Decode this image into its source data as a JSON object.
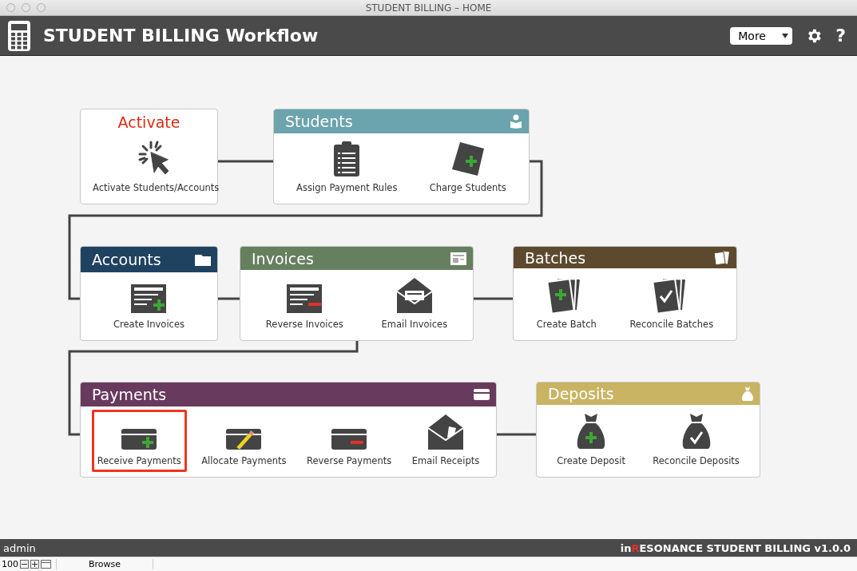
{
  "window": {
    "title": "STUDENT BILLING – HOME"
  },
  "toolbar": {
    "title": "STUDENT BILLING Workflow",
    "menu": "More",
    "help": "?"
  },
  "cards": [
    {
      "title": "Activate",
      "kind": "plain",
      "actions": [
        {
          "label": "Activate Students/Accounts",
          "selected": false
        }
      ]
    },
    {
      "title": "Students",
      "kind": "header",
      "color": "#6ba4ad",
      "actions": [
        {
          "label": "Assign Payment Rules",
          "selected": false
        },
        {
          "label": "Charge Students",
          "selected": false
        }
      ]
    },
    {
      "title": "Accounts",
      "kind": "header",
      "color": "#1f4261",
      "actions": [
        {
          "label": "Create Invoices",
          "selected": false
        }
      ]
    },
    {
      "title": "Invoices",
      "kind": "header",
      "color": "#66805f",
      "actions": [
        {
          "label": "Reverse Invoices",
          "selected": false
        },
        {
          "label": "Email Invoices",
          "selected": false
        }
      ]
    },
    {
      "title": "Batches",
      "kind": "header",
      "color": "#5d4a2e",
      "actions": [
        {
          "label": "Create Batch",
          "selected": false
        },
        {
          "label": "Reconcile Batches",
          "selected": false
        }
      ]
    },
    {
      "title": "Payments",
      "kind": "header",
      "color": "#683a5d",
      "actions": [
        {
          "label": "Receive Payments",
          "selected": true
        },
        {
          "label": "Allocate Payments",
          "selected": false
        },
        {
          "label": "Reverse Payments",
          "selected": false
        },
        {
          "label": "Email Receipts",
          "selected": false
        }
      ]
    },
    {
      "title": "Deposits",
      "kind": "header",
      "color": "#c8b463",
      "actions": [
        {
          "label": "Create Deposit",
          "selected": false
        },
        {
          "label": "Reconcile Deposits",
          "selected": false
        }
      ]
    }
  ],
  "status_bar": {
    "user": "admin",
    "brand": {
      "prefix": "in",
      "accent": "R",
      "rest": "ESONANCE STUDENT BILLING v1.0.0"
    }
  },
  "bottom_bar": {
    "zoom": "100",
    "mode": "Browse"
  }
}
